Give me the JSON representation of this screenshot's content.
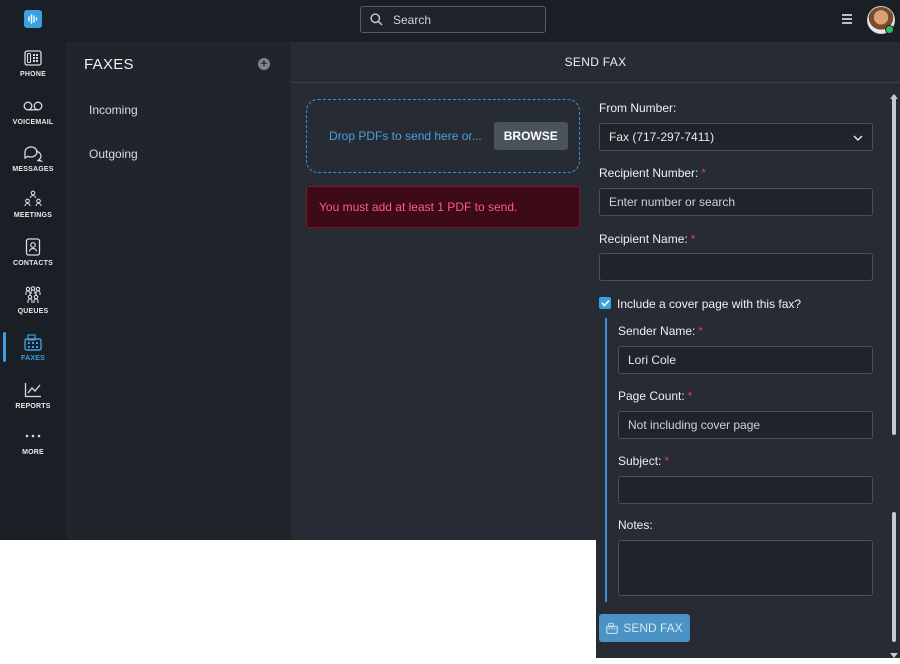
{
  "rail": {
    "items": [
      {
        "label": "PHONE",
        "icon": "phone-icon"
      },
      {
        "label": "VOICEMAIL",
        "icon": "voicemail-icon"
      },
      {
        "label": "MESSAGES",
        "icon": "messages-icon"
      },
      {
        "label": "MEETINGS",
        "icon": "meetings-icon"
      },
      {
        "label": "CONTACTS",
        "icon": "contacts-icon"
      },
      {
        "label": "QUEUES",
        "icon": "queues-icon"
      },
      {
        "label": "FAXES",
        "icon": "fax-icon",
        "active": true
      },
      {
        "label": "REPORTS",
        "icon": "reports-icon"
      },
      {
        "label": "MORE",
        "icon": "more-icon"
      }
    ]
  },
  "topbar": {
    "search_placeholder": "Search"
  },
  "faxes_panel": {
    "title": "FAXES",
    "links": [
      {
        "label": "Incoming"
      },
      {
        "label": "Outgoing"
      }
    ]
  },
  "send_fax": {
    "header": "SEND FAX",
    "dropzone_text": "Drop PDFs to send here or...",
    "browse_label": "BROWSE",
    "error_text": "You must add at least 1 PDF to send.",
    "from_number_label": "From Number:",
    "from_number_value": "Fax (717-297-7411)",
    "recipient_number_label": "Recipient Number:",
    "recipient_number_placeholder": "Enter number or search",
    "recipient_name_label": "Recipient Name:",
    "cover_page_label": "Include a cover page with this fax?",
    "cover_page_checked": true,
    "sender_name_label": "Sender Name:",
    "sender_name_value": "Lori Cole",
    "page_count_label": "Page Count:",
    "page_count_placeholder": "Not including cover page",
    "subject_label": "Subject:",
    "notes_label": "Notes:",
    "required_mark": "*",
    "send_label": "SEND FAX"
  },
  "colors": {
    "accent": "#3aa0e0",
    "error_text": "#ff5c86",
    "error_bg": "#3d0a18",
    "required": "#e23b5b"
  }
}
